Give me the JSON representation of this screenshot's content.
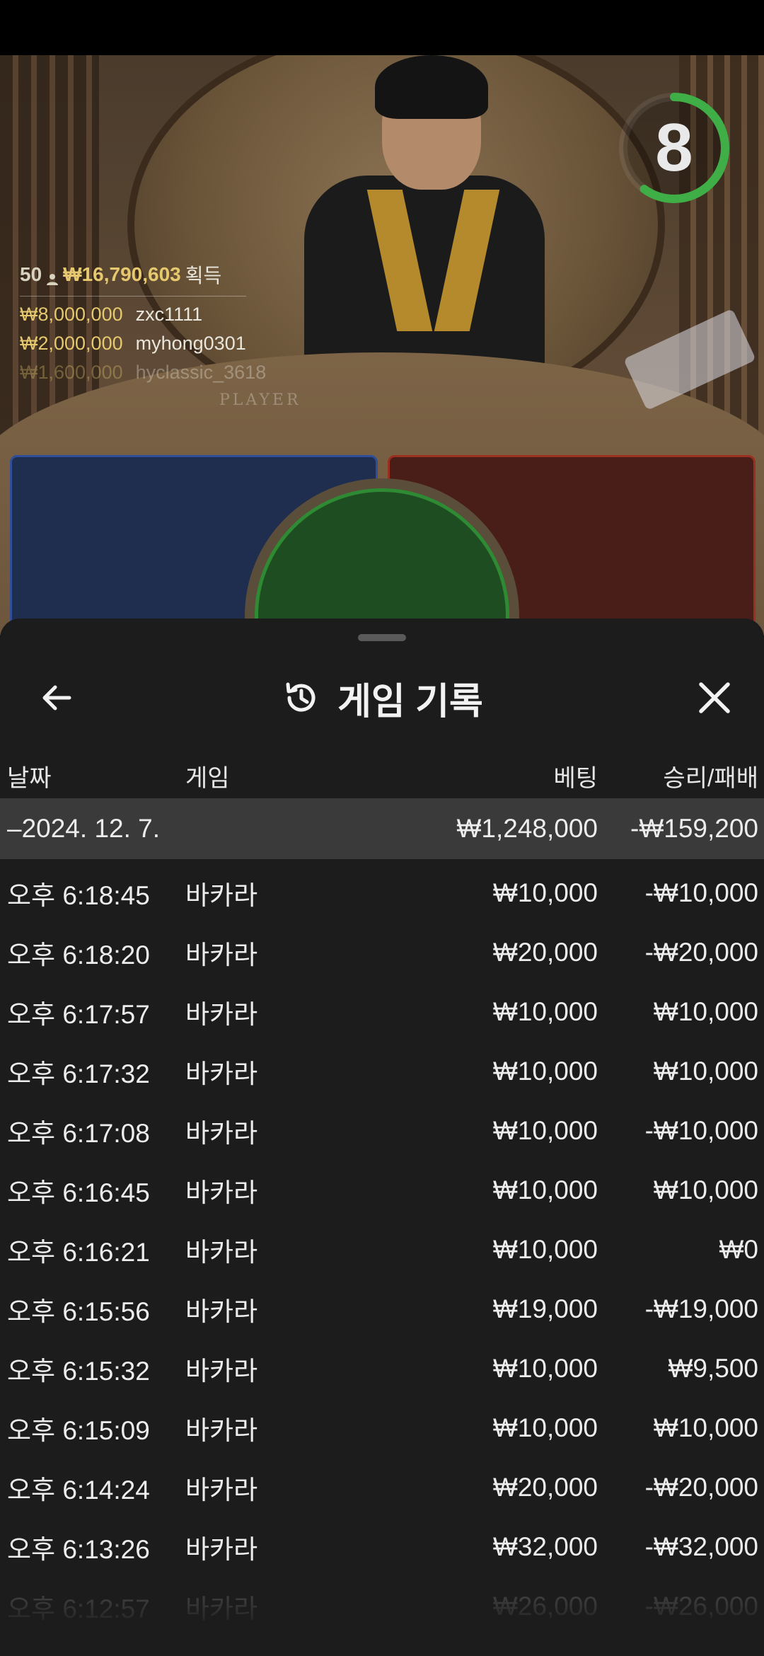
{
  "overlay": {
    "player_count": "50",
    "total_winnings": "₩16,790,603",
    "winnings_label": "획득",
    "winners": [
      {
        "amount": "₩8,000,000",
        "name": "zxc1111"
      },
      {
        "amount": "₩2,000,000",
        "name": "myhong0301"
      },
      {
        "amount": "₩1,600,000",
        "name": "hyclassic_3618"
      }
    ],
    "table_text": "PLAYER",
    "timer_value": "8",
    "timer_progress": 0.6,
    "timer_color": "#3fae47"
  },
  "sheet": {
    "title": "게임 기록",
    "title_icon": "history-icon",
    "back_icon": "arrow-left-icon",
    "close_icon": "close-icon"
  },
  "table": {
    "headers": {
      "date": "날짜",
      "game": "게임",
      "bet": "베팅",
      "result": "승리/패배"
    },
    "summary": {
      "date": "–2024. 12. 7.",
      "bet": "₩1,248,000",
      "result": "-₩159,200"
    },
    "rows": [
      {
        "time": "오후 6:18:45",
        "game": "바카라",
        "bet": "₩10,000",
        "result": "-₩10,000"
      },
      {
        "time": "오후 6:18:20",
        "game": "바카라",
        "bet": "₩20,000",
        "result": "-₩20,000"
      },
      {
        "time": "오후 6:17:57",
        "game": "바카라",
        "bet": "₩10,000",
        "result": "₩10,000"
      },
      {
        "time": "오후 6:17:32",
        "game": "바카라",
        "bet": "₩10,000",
        "result": "₩10,000"
      },
      {
        "time": "오후 6:17:08",
        "game": "바카라",
        "bet": "₩10,000",
        "result": "-₩10,000"
      },
      {
        "time": "오후 6:16:45",
        "game": "바카라",
        "bet": "₩10,000",
        "result": "₩10,000"
      },
      {
        "time": "오후 6:16:21",
        "game": "바카라",
        "bet": "₩10,000",
        "result": "₩0"
      },
      {
        "time": "오후 6:15:56",
        "game": "바카라",
        "bet": "₩19,000",
        "result": "-₩19,000"
      },
      {
        "time": "오후 6:15:32",
        "game": "바카라",
        "bet": "₩10,000",
        "result": "₩9,500"
      },
      {
        "time": "오후 6:15:09",
        "game": "바카라",
        "bet": "₩10,000",
        "result": "₩10,000"
      },
      {
        "time": "오후 6:14:24",
        "game": "바카라",
        "bet": "₩20,000",
        "result": "-₩20,000"
      },
      {
        "time": "오후 6:13:26",
        "game": "바카라",
        "bet": "₩32,000",
        "result": "-₩32,000"
      },
      {
        "time": "오후 6:12:57",
        "game": "바카라",
        "bet": "₩26,000",
        "result": "-₩26,000"
      }
    ]
  }
}
